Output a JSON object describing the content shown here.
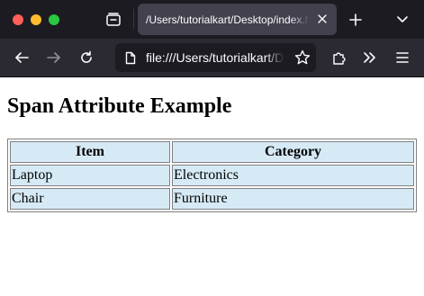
{
  "browser": {
    "tab": {
      "title": "/Users/tutorialkart/Desktop/index.html"
    },
    "address_bar": {
      "url": "file:///Users/tutorialkart/Desktop/index.html"
    },
    "icons": {
      "tab_groups": "tab-groups-icon",
      "tab_close": "close-icon",
      "new_tab": "plus-icon",
      "tab_list": "chevron-down-icon",
      "back": "back-arrow-icon",
      "forward": "forward-arrow-icon",
      "reload": "reload-icon",
      "page": "page-icon",
      "bookmark": "star-icon",
      "extensions": "puzzle-icon",
      "overflow": "double-chevron-icon",
      "menu": "hamburger-icon"
    },
    "colors": {
      "tabstrip_bg": "#1c1b22",
      "toolbar_bg": "#2b2a33",
      "active_tab_bg": "#42414d",
      "traffic_close": "#fe5f57",
      "traffic_min": "#febc2e",
      "traffic_max": "#28c840"
    }
  },
  "page": {
    "heading": "Span Attribute Example",
    "table": {
      "headers": [
        "Item",
        "Category"
      ],
      "rows": [
        [
          "Laptop",
          "Electronics"
        ],
        [
          "Chair",
          "Furniture"
        ]
      ],
      "cell_bg": "#d6eaf6",
      "border_color": "#808080"
    }
  }
}
